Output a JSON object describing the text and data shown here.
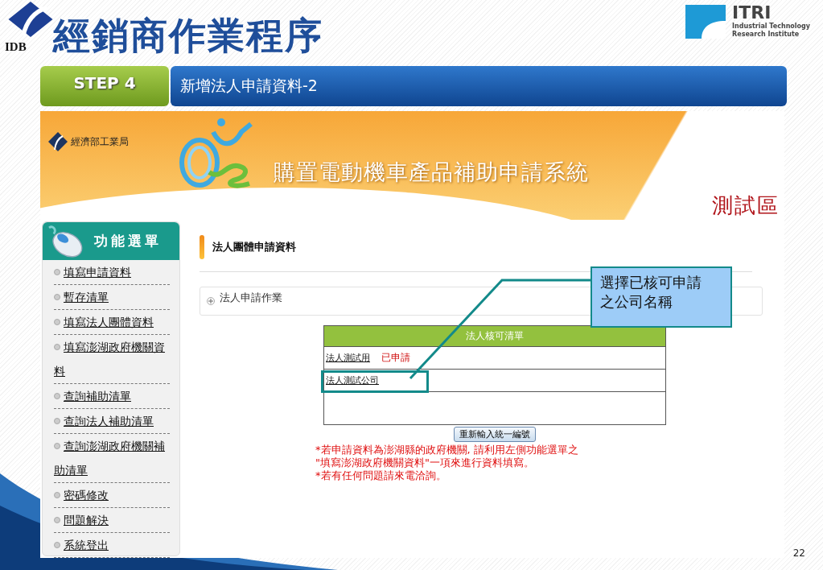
{
  "header": {
    "logo_text": "IDB",
    "title": "經銷商作業程序",
    "partner_logo": {
      "name": "ITRI",
      "line_1": "Industrial Technology",
      "line_2": "Research Institute"
    }
  },
  "step": {
    "badge": "STEP 4",
    "title": "新增法人申請資料-2"
  },
  "screen": {
    "banner": {
      "agency": "經濟部工業局",
      "system_title": "購置電動機車產品補助申請系統",
      "environment": "測試區"
    },
    "sidebar": {
      "title": "功能選單",
      "items": [
        "填寫申請資料",
        "暫存清單",
        "填寫法人團體資料",
        "填寫澎湖政府機關資料",
        "查詢補助清單",
        "查詢法人補助清單",
        "查詢澎湖政府機關補助清單",
        "密碼修改",
        "問題解決",
        "系統登出"
      ]
    },
    "section_title": "法人團體申請資料",
    "panel": {
      "label": "法人申請作業",
      "expanded": false
    },
    "table": {
      "header": "法人核可清單",
      "rows": [
        {
          "name": "法人測試用",
          "status": "已申請"
        },
        {
          "name": "法人測試公司",
          "highlighted": true
        }
      ]
    },
    "reset_button": "重新輸入統一編號",
    "notes": [
      "*若申請資料為澎湖縣的政府機關, 請利用左側功能選單之",
      "\"填寫澎湖政府機關資料\"一項來進行資料填寫。",
      "*若有任何問題請來電洽詢。"
    ]
  },
  "callout": {
    "text": "選擇已核可申請之公司名稱"
  },
  "page_number": "22"
}
